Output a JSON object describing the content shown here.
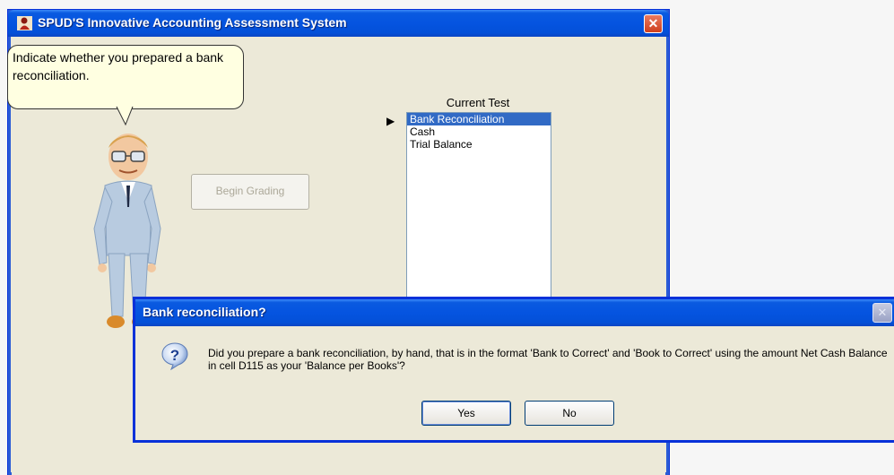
{
  "window": {
    "title": "SPUD'S Innovative Accounting Assessment System",
    "close_glyph": "✕",
    "icon": "app-logo-icon"
  },
  "bubble": {
    "text": "Indicate whether you prepared a bank reconciliation."
  },
  "buttons": {
    "begin_grading": "Begin Grading"
  },
  "current_test": {
    "label": "Current Test",
    "pointer_glyph": "▶",
    "items": [
      "Bank Reconciliation",
      "Cash",
      "Trial Balance"
    ],
    "selected": "Bank Reconciliation"
  },
  "dialog": {
    "title": "Bank reconciliation?",
    "close_glyph": "✕",
    "icon": "question-icon",
    "message": "Did you prepare a bank reconciliation, by hand, that is in the format 'Bank to Correct' and 'Book to Correct' using the amount Net Cash Balance in cell D115 as your 'Balance per Books'?",
    "yes_label": "Yes",
    "no_label": "No"
  },
  "colors": {
    "titlebar_blue": "#0554e0",
    "window_face": "#ece9d8",
    "selection": "#316ac5",
    "bubble_fill": "#ffffe1"
  }
}
